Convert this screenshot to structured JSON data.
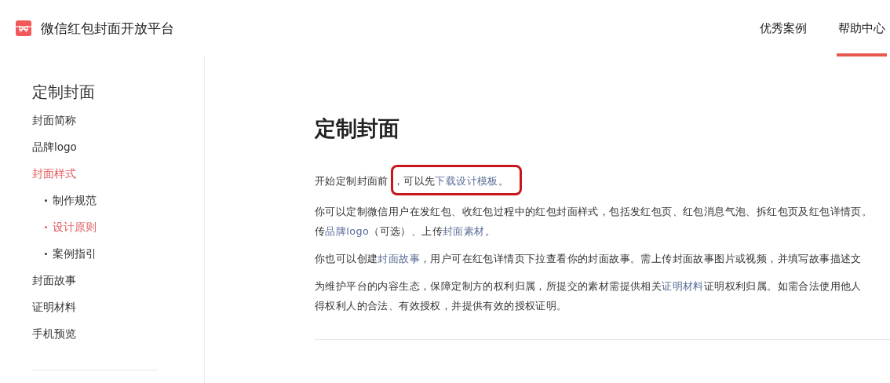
{
  "header": {
    "title": "微信红包封面开放平台",
    "tabs": [
      {
        "label": "优秀案例",
        "selected": false
      },
      {
        "label": "帮助中心",
        "selected": true
      }
    ]
  },
  "sidebar": {
    "title": "定制封面",
    "items": [
      {
        "label": "封面简称",
        "selected": false
      },
      {
        "label": "品牌logo",
        "selected": false
      },
      {
        "label": "封面样式",
        "selected": true,
        "children": [
          {
            "label": "制作规范",
            "selected": false
          },
          {
            "label": "设计原则",
            "selected": true
          },
          {
            "label": "案例指引",
            "selected": false
          }
        ]
      },
      {
        "label": "封面故事",
        "selected": false
      },
      {
        "label": "证明材料",
        "selected": false
      },
      {
        "label": "手机预览",
        "selected": false
      }
    ]
  },
  "content": {
    "heading": "定制封面",
    "paragraphs": [
      {
        "lines": [
          {
            "parts": [
              {
                "text": "开始定制封面前",
                "link": false
              }
            ],
            "marked": [
              {
                "text": "，可以先",
                "link": false
              },
              {
                "text": "下载设计模板",
                "link": true
              },
              {
                "text": "。",
                "link": false
              }
            ]
          }
        ]
      },
      {
        "lines": [
          {
            "parts": [
              {
                "text": "你可以定制微信用户在发红包、收红包过程中的红包封面样式，包括发红包页、红包消息气泡、拆红包页及红包详情页。",
                "link": false
              }
            ]
          },
          {
            "parts": [
              {
                "text": "传",
                "link": false
              },
              {
                "text": "品牌logo",
                "link": true
              },
              {
                "text": "（可选）、上传",
                "link": false
              },
              {
                "text": "封面素材",
                "link": true
              },
              {
                "text": "。",
                "link": false
              }
            ]
          }
        ]
      },
      {
        "lines": [
          {
            "parts": [
              {
                "text": "你也可以创建",
                "link": false
              },
              {
                "text": "封面故事",
                "link": true
              },
              {
                "text": "，用户可在红包详情页下拉查看你的封面故事。需上传封面故事图片或视频，并填写故事描述文",
                "link": false
              }
            ]
          }
        ]
      },
      {
        "lines": [
          {
            "parts": [
              {
                "text": "为维护平台的内容生态，保障定制方的权利归属，所提交的素材需提供相关",
                "link": false
              },
              {
                "text": "证明材料",
                "link": true
              },
              {
                "text": "证明权利归属。如需合法使用他人",
                "link": false
              }
            ]
          },
          {
            "parts": [
              {
                "text": "得权利人的合法、有效授权，并提供有效的授权证明。",
                "link": false
              }
            ]
          }
        ]
      }
    ]
  }
}
